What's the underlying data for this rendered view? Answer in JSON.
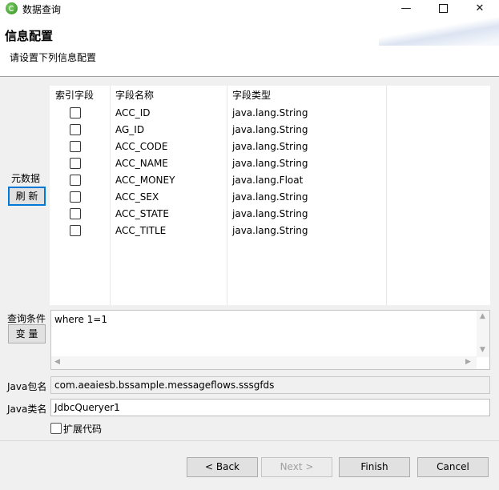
{
  "window": {
    "title": "数据查询",
    "minimize_glyph": "—",
    "close_glyph": "✕"
  },
  "header": {
    "title": "信息配置",
    "description": "请设置下列信息配置"
  },
  "metadata": {
    "label": "元数据",
    "refresh_label": "刷 新"
  },
  "table": {
    "headers": {
      "index": "索引字段",
      "name": "字段名称",
      "type": "字段类型"
    },
    "rows": [
      {
        "name": "ACC_ID",
        "type": "java.lang.String"
      },
      {
        "name": "AG_ID",
        "type": "java.lang.String"
      },
      {
        "name": "ACC_CODE",
        "type": "java.lang.String"
      },
      {
        "name": "ACC_NAME",
        "type": "java.lang.String"
      },
      {
        "name": "ACC_MONEY",
        "type": "java.lang.Float"
      },
      {
        "name": "ACC_SEX",
        "type": "java.lang.String"
      },
      {
        "name": "ACC_STATE",
        "type": "java.lang.String"
      },
      {
        "name": "ACC_TITLE",
        "type": "java.lang.String"
      }
    ]
  },
  "query": {
    "label": "查询条件",
    "variable_label": "变 量",
    "value": "where 1=1"
  },
  "java_package": {
    "label": "Java包名",
    "value": "com.aeaiesb.bssample.messageflows.sssgfds"
  },
  "java_class": {
    "label": "Java类名",
    "value": "JdbcQueryer1"
  },
  "extend_code": {
    "label": "扩展代码"
  },
  "buttons": {
    "back": "< Back",
    "next": "Next >",
    "finish": "Finish",
    "cancel": "Cancel"
  }
}
